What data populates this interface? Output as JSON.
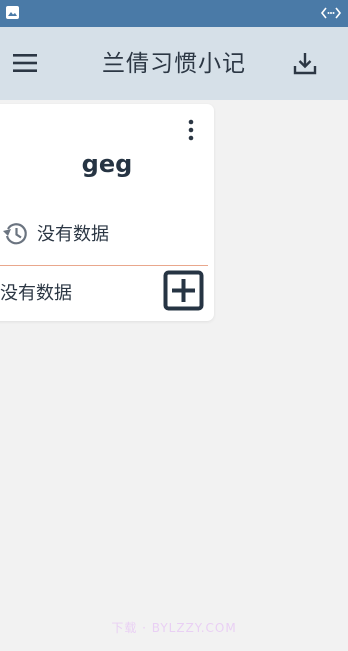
{
  "status_bar": {
    "left_icon": "gallery-icon",
    "right_icon": "code-icon"
  },
  "app_bar": {
    "title": "兰倩习惯小记",
    "menu_icon": "menu-icon",
    "download_icon": "download-icon"
  },
  "card": {
    "title": "geg",
    "history_text": "没有数据",
    "bottom_text": "没有数据",
    "more_icon": "more-vert-icon",
    "history_icon": "history-icon",
    "add_icon": "add-box-icon"
  },
  "watermark": {
    "text": "下载 · BYLZZY.COM"
  },
  "colors": {
    "status_bar": "#4a7aa7",
    "app_bar": "#d6e0e8",
    "background": "#f2f2f2",
    "divider": "#e9a78c",
    "text": "#2c3744"
  }
}
